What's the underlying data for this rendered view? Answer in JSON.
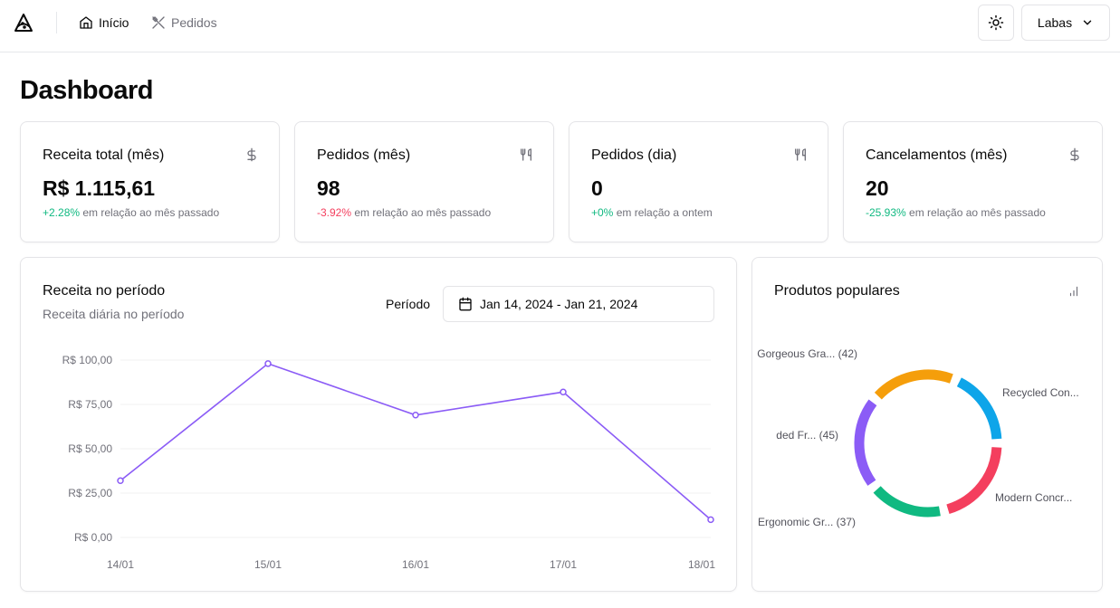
{
  "header": {
    "nav": [
      {
        "label": "Início",
        "icon": "home-icon"
      },
      {
        "label": "Pedidos",
        "icon": "utensils-crossed-icon"
      }
    ],
    "account_label": "Labas"
  },
  "page": {
    "title": "Dashboard"
  },
  "stats": [
    {
      "label": "Receita total (mês)",
      "icon": "dollar-icon",
      "value": "R$ 1.115,61",
      "change": "+2.28%",
      "change_type": "pos",
      "desc": " em relação ao mês passado"
    },
    {
      "label": "Pedidos (mês)",
      "icon": "utensils-icon",
      "value": "98",
      "change": "-3.92%",
      "change_type": "neg",
      "desc": " em relação ao mês passado"
    },
    {
      "label": "Pedidos (dia)",
      "icon": "utensils-icon",
      "value": "0",
      "change": "+0%",
      "change_type": "pos",
      "desc": " em relação a ontem"
    },
    {
      "label": "Cancelamentos (mês)",
      "icon": "dollar-icon",
      "value": "20",
      "change": "-25.93%",
      "change_type": "pos",
      "desc": " em relação ao mês passado"
    }
  ],
  "revenue": {
    "title": "Receita no período",
    "subtitle": "Receita diária no período",
    "period_label": "Período",
    "date_range": "Jan 14, 2024 - Jan 21, 2024"
  },
  "popular": {
    "title": "Produtos populares"
  },
  "chart_data": [
    {
      "type": "line",
      "x": [
        "14/01",
        "15/01",
        "16/01",
        "17/01",
        "18/01"
      ],
      "series": [
        {
          "values": [
            32,
            98,
            69,
            82,
            10
          ]
        }
      ],
      "yticks": [
        "R$ 0,00",
        "R$ 25,00",
        "R$ 50,00",
        "R$ 75,00",
        "R$ 100,00"
      ],
      "ylim": [
        0,
        100
      ],
      "color": "#8b5cf6",
      "grid": true
    },
    {
      "type": "pie",
      "donut": true,
      "slices": [
        {
          "label": "Gorgeous Gra... (42)",
          "value": 42,
          "color": "#f59e0b"
        },
        {
          "label": "Recycled Con...",
          "value": 38,
          "color": "#0ea5e9"
        },
        {
          "label": "Modern Concr...",
          "value": 44,
          "color": "#f43f5e"
        },
        {
          "label": "Ergonomic Gr... (37)",
          "value": 37,
          "color": "#10b981"
        },
        {
          "label": "ded Fr... (45)",
          "value": 45,
          "color": "#8b5cf6"
        }
      ],
      "colors": {
        "accent": "#8b5cf6"
      }
    }
  ]
}
